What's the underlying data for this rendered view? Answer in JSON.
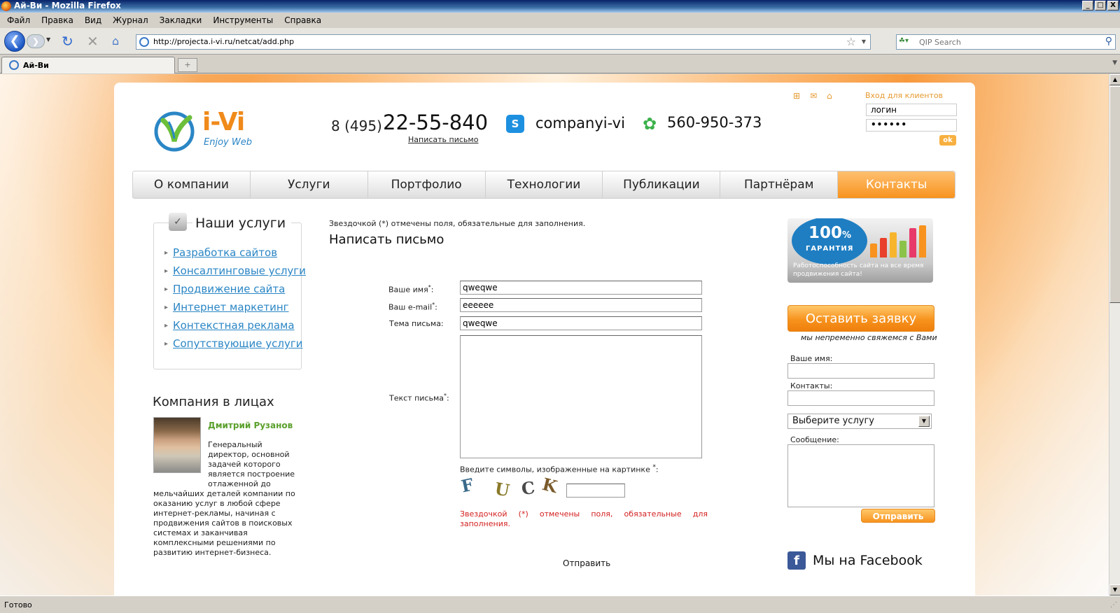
{
  "window": {
    "title": "Ай-Ви - Mozilla Firefox",
    "buttons": [
      "_",
      "□",
      "X"
    ]
  },
  "menu": [
    "Файл",
    "Правка",
    "Вид",
    "Журнал",
    "Закладки",
    "Инструменты",
    "Справка"
  ],
  "navbar": {
    "url": "http://projecta.i-vi.ru/netcat/add.php",
    "search_placeholder": "QIP Search"
  },
  "tab": {
    "label": "Ай-Ви"
  },
  "status": {
    "text": "Готово"
  },
  "header": {
    "brand": "i-Vi",
    "tagline": "Enjoy Web",
    "phone_code": "8 (495)",
    "phone_number": "22-55-840",
    "write_link": "Написать письмо",
    "skype": "companyi-vi",
    "icq": "560-950-373",
    "login_label": "Вход для клиентов",
    "login_value": "логин",
    "password_value": "••••••",
    "ok_label": "ok"
  },
  "nav": {
    "items": [
      "О компании",
      "Услуги",
      "Портфолио",
      "Технологии",
      "Публикации",
      "Партнёрам",
      "Контакты"
    ],
    "active": "Контакты"
  },
  "sidebar": {
    "services_title": "Наши услуги",
    "services": [
      "Разработка сайтов",
      "Консалтинговые услуги",
      "Продвижение сайта",
      "Интернет маркетинг",
      "Контекстная реклама",
      "Сопутствующие услуги"
    ],
    "company_title": "Компания в лицах",
    "person_name": "Дмитрий Рузанов",
    "bio_top": [
      "Генеральный",
      "директор, основной",
      "задачей которого",
      "является построение",
      "отлаженной до"
    ],
    "bio_bottom": "мельчайших деталей компании по оказанию услуг в любой сфере интернет-рекламы, начиная с продвижения сайтов в поисковых системах и заканчивая комплексными решениями по развитию интернет-бизнеса."
  },
  "form": {
    "required_note": "Звездочкой (*) отмечены поля, обязательные для заполнения.",
    "title": "Написать письмо",
    "name_label": "Ваше имя",
    "name_value": "qweqwe",
    "email_label": "Ваш e-mail",
    "email_value": "eeeeee",
    "subject_label": "Тема письма:",
    "subject_value": "qweqwe",
    "message_label": "Текст письма",
    "captcha_label": "Введите символы, изображенные на картинке",
    "captcha_chars": [
      "F",
      "U",
      "C",
      "K"
    ],
    "red_note": "Звездочкой (*) отмечены поля, обязательные для заполнения.",
    "submit_label": "Отправить",
    "star": "*",
    "colon": ":"
  },
  "right": {
    "guarantee_num": "100",
    "guarantee_pct": "%",
    "guarantee_word": "ГАРАНТИЯ",
    "guarantee_text": "Работоспособность сайта на все время продвижения сайта!",
    "order_button": "Оставить заявку",
    "order_sub": "мы непременно свяжемся с Вами",
    "name_label": "Ваше имя:",
    "contacts_label": "Контакты:",
    "service_select": "Выберите услугу",
    "message_label": "Сообщение:",
    "send_button": "Отправить",
    "facebook": "Мы на Facebook"
  },
  "colors": {
    "accent_orange": "#f7931e",
    "link_blue": "#2b86c5",
    "name_green": "#5aa02c",
    "error_red": "#d42020"
  },
  "icons": [
    "firefox-icon",
    "back-icon",
    "forward-icon",
    "reload-icon",
    "stop-icon",
    "home-icon",
    "star-icon",
    "search-icon",
    "skype-icon",
    "icq-icon",
    "facebook-icon"
  ]
}
